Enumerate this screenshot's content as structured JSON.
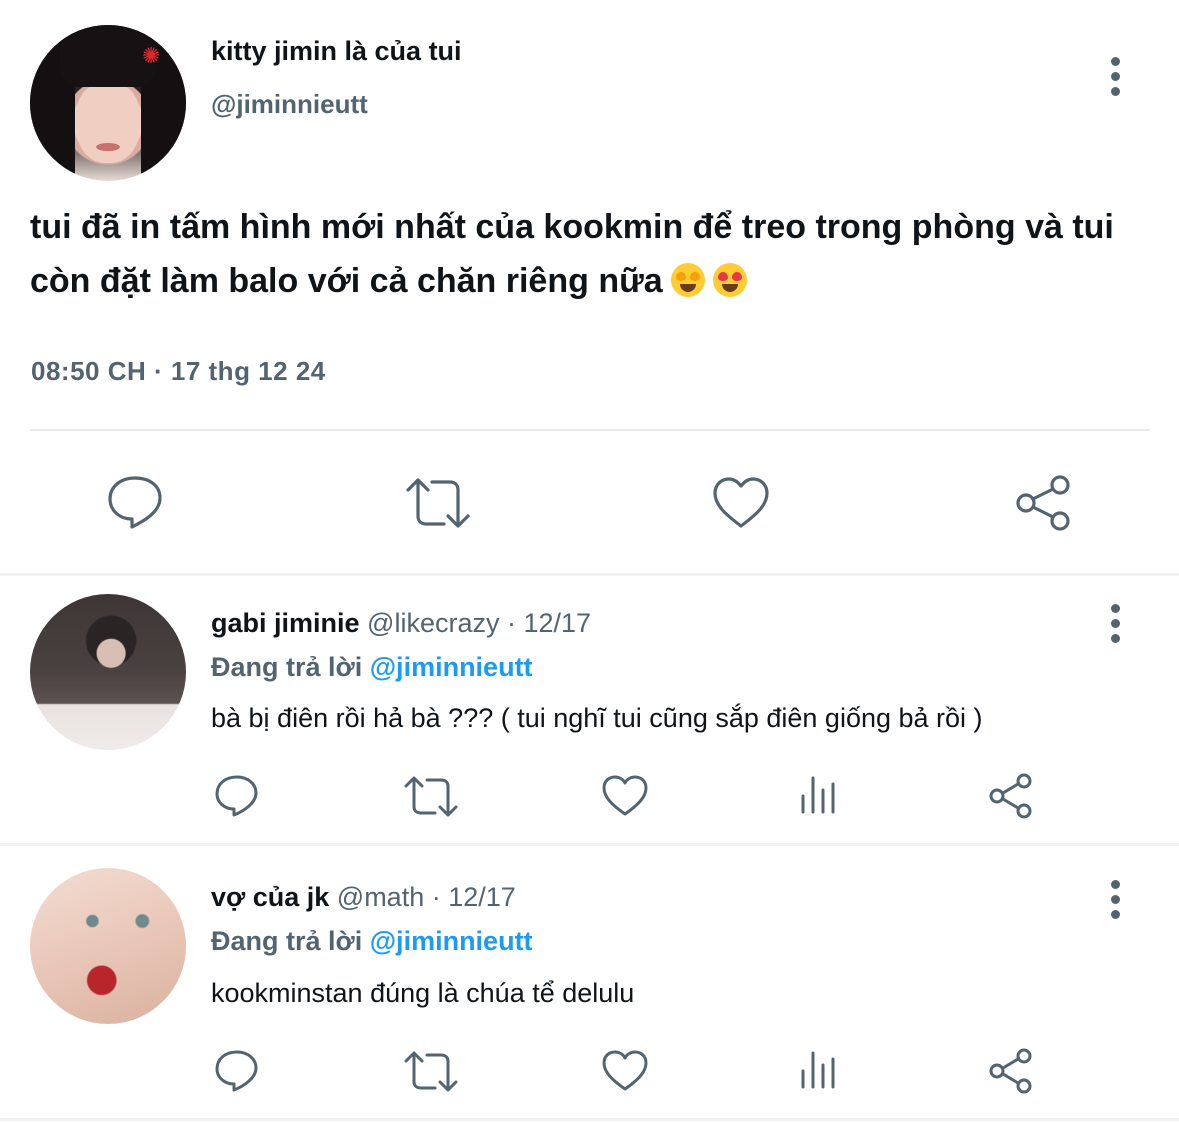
{
  "main_tweet": {
    "display_name": "kitty jimin là của tui",
    "handle": "@jiminnieutt",
    "text": "tui đã in tấm hình mới nhất của kookmin để treo trong phòng và tui còn đặt làm balo với cả chăn riêng nữa",
    "emojis": [
      "star-struck-emoji",
      "heart-eyes-emoji"
    ],
    "timestamp": "08:50 CH · 17 thg 12 24",
    "actions": [
      "reply-icon",
      "retweet-icon",
      "like-icon",
      "share-icon"
    ]
  },
  "replies": [
    {
      "display_name": "gabi jiminie",
      "handle": "@likecrazy",
      "date": "· 12/17",
      "replying_prefix": "Đang trả lời",
      "replying_to": "@jiminnieutt",
      "text": "bà bị điên rồi hả bà ??? ( tui nghĩ tui cũng sắp điên giống bả rồi )"
    },
    {
      "display_name": "vợ của jk",
      "handle": "@math",
      "date": "· 12/17",
      "replying_prefix": "Đang trả lời",
      "replying_to": "@jiminnieutt",
      "text": "kookminstan đúng là chúa tể delulu"
    }
  ],
  "colors": {
    "text": "#0f1419",
    "secondary": "#536471",
    "link": "#1d9bf0",
    "divider": "#e7e9ea"
  }
}
